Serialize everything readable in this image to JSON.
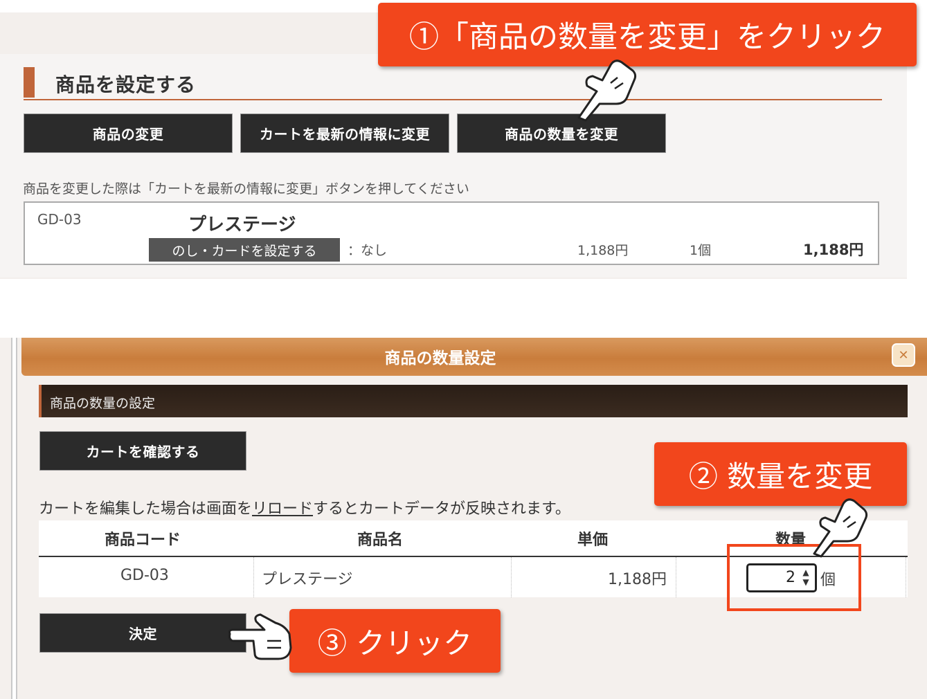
{
  "top_panel": {
    "section_title": "商品を設定する",
    "buttons": {
      "change_item": "商品の変更",
      "update_cart": "カートを最新の情報に変更",
      "change_qty": "商品の数量を変更"
    },
    "note": "商品を変更した際は「カートを最新の情報に変更」ボタンを押してください",
    "item": {
      "code": "GD-03",
      "name": "プレステージ",
      "noshi_button": "のし・カードを設定する",
      "noshi_value": "：なし",
      "unit_price": "1,188円",
      "quantity": "1個",
      "subtotal": "1,188円"
    }
  },
  "callouts": {
    "step1": "①「商品の数量を変更」をクリック",
    "step2": "② 数量を変更",
    "step3": "③ クリック"
  },
  "dialog": {
    "title": "商品の数量設定",
    "close_symbol": "✕",
    "sub_title": "商品の数量の設定",
    "check_cart_button": "カートを確認する",
    "note_before": "カートを編集した場合は画面を",
    "note_link": "リロード",
    "note_after": "するとカートデータが反映されます。",
    "table": {
      "headers": [
        "商品コード",
        "商品名",
        "単価",
        "数量"
      ],
      "row": {
        "code": "GD-03",
        "name": "プレステージ",
        "unit_price": "1,188円",
        "quantity": "2",
        "unit": "個"
      }
    },
    "submit_button": "決定"
  },
  "colors": {
    "accent": "#c0653a",
    "callout": "#f2461c",
    "dark_button": "#2b2b2b",
    "dialog_header": "#c97d3c"
  }
}
